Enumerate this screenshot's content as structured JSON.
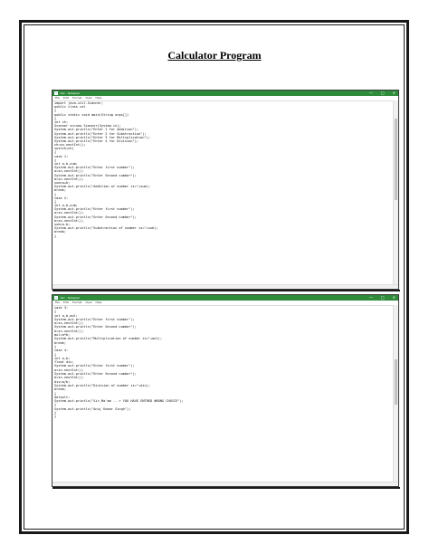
{
  "page": {
    "title": "Calculator Program"
  },
  "window1": {
    "title": "calc - Notepad",
    "controls": [
      "—",
      "□",
      "✕"
    ],
    "menu": [
      "File",
      "Edit",
      "Format",
      "View",
      "Help"
    ],
    "code": [
      "import java.util.Scanner;",
      "public class cal",
      "{",
      "public static void main(String args[])",
      "{",
      "int ch;",
      "Scanner sn=new Scanner(System.in);",
      "System.out.println(\"Enter 1 for Addition\");",
      "System.out.println(\"Enter 2 for Substraction\");",
      "System.out.println(\"Enter 3 for Multiplication\");",
      "System.out.println(\"Enter 4 for Division\");",
      "ch=sn.nextInt();",
      "switch(ch)",
      "{",
      "case 1:",
      "{",
      "int a,b,sum;",
      "System.out.println(\"Enter first number\");",
      "a=sn.nextInt();",
      "System.out.println(\"Enter Second number\");",
      "b=sn.nextInt();",
      "sum=a+b;",
      "System.out.println(\"Addition of number is=\"+sum);",
      "break;",
      "}",
      "case 2:",
      "{",
      "int a,b,sub;",
      "System.out.println(\"Enter first number\");",
      "a=sn.nextInt();",
      "System.out.println(\"Enter Second number\");",
      "b=sn.nextInt();",
      "sub=a-b;",
      "System.out.println(\"Substraction of number is=\"+sub);",
      "break;",
      "}"
    ]
  },
  "window2": {
    "title": "calc - Notepad",
    "controls": [
      "—",
      "□",
      "✕"
    ],
    "menu": [
      "File",
      "Edit",
      "Format",
      "View",
      "Help"
    ],
    "code": [
      "case 3:",
      "{",
      "int a,b,mul;",
      "System.out.println(\"Enter first number\");",
      "a=sn.nextInt();",
      "System.out.println(\"Enter Second number\");",
      "b=sn.nextInt();",
      "mul=a*b;",
      "System.out.println(\"Multiplication of number is=\"+mul);",
      "break;",
      "}",
      "case 4:",
      "{",
      "int a,b;",
      "float div;",
      "System.out.println(\"Enter first number\");",
      "a=sn.nextInt();",
      "System.out.println(\"Enter Second number\");",
      "b=sn.nextInt();",
      "div=a/b;",
      "System.out.println(\"Division of number is=\"+div);",
      "break;",
      "}",
      "default:",
      "System.out.println(\"Sir,Ma'am -- > YOU HAVE ENTRED WRONG CHOICE\");",
      "}",
      "System.out.println(\"Anuj Kumar Singh\");",
      "}",
      "}"
    ]
  }
}
